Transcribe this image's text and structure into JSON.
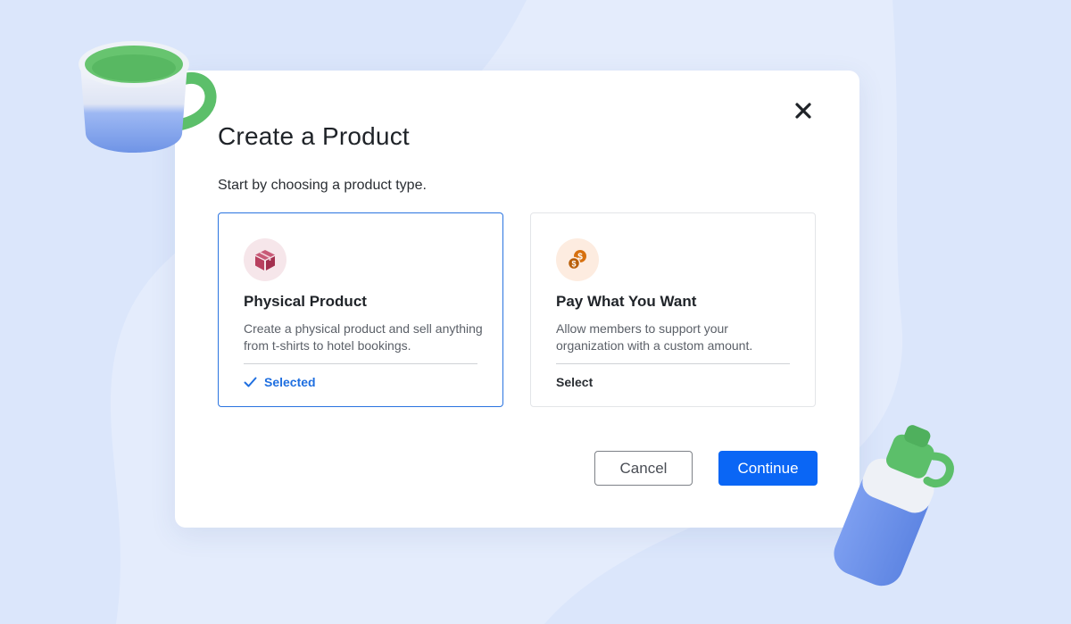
{
  "modal": {
    "title": "Create a Product",
    "subtitle": "Start by choosing a product type.",
    "close_icon": "close-icon"
  },
  "cards": [
    {
      "title": "Physical Product",
      "description": "Create a physical product and sell anything from t-shirts to hotel bookings.",
      "status": "Selected",
      "selected": true,
      "icon": "box-icon"
    },
    {
      "title": "Pay What You Want",
      "description": "Allow members to support your organization with a custom amount.",
      "status": "Select",
      "selected": false,
      "icon": "coins-icon"
    }
  ],
  "actions": {
    "cancel_label": "Cancel",
    "continue_label": "Continue"
  },
  "colors": {
    "accent": "#0a66f5",
    "selected_border": "#2a74e0",
    "background": "#dbe6fb"
  }
}
